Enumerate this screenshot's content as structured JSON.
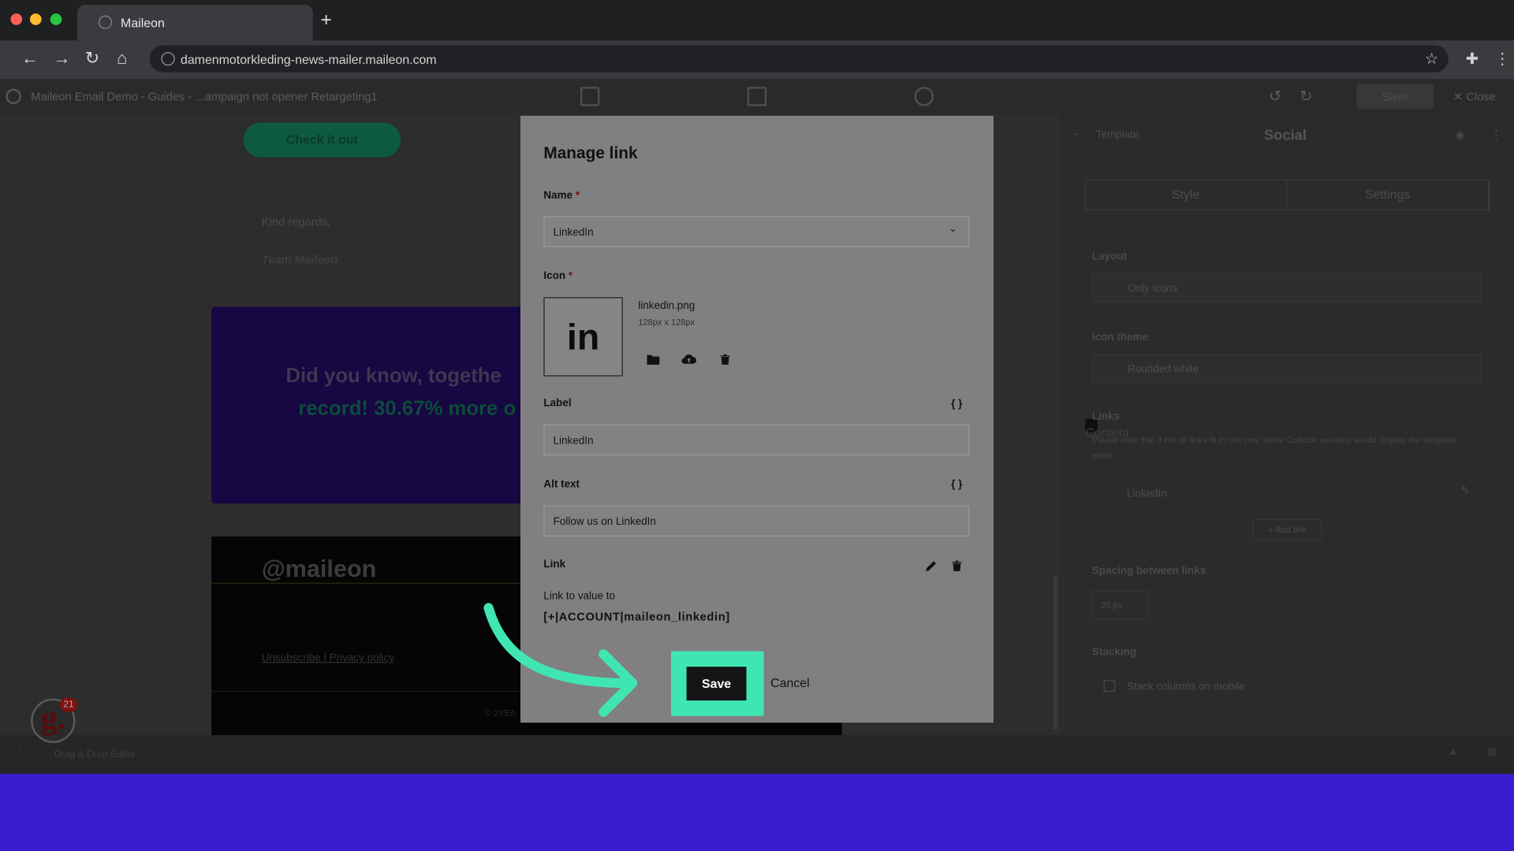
{
  "browser": {
    "tab_title": "Maileon",
    "url": "damenmotorkleding-news-mailer.maileon.com",
    "new_tab": "+"
  },
  "app_header": {
    "title": "Maileon Email Demo - Guides - ...ampaign not opener Retargeting1",
    "save": "Save",
    "close": "✕ Close"
  },
  "canvas": {
    "cta": "Check it out",
    "kind_regards": "Kind regards,",
    "team": "Team Maileon",
    "banner_line1": "Did you know, togethe",
    "banner_line2": "record! 30.67% more o",
    "footer_logo": "@maileon",
    "footer_links": "Unsubscribe | Privacy policy",
    "footer_copy": "© 2YEA"
  },
  "panel": {
    "breadcrumb": "Template",
    "title": "Social",
    "tabs": [
      "Content",
      "Style",
      "Settings"
    ],
    "layout_label": "Layout",
    "layout_value": "Only icons",
    "theme_label": "Icon theme",
    "theme_value": "Rounded white",
    "links_label": "Links",
    "links_note": "Please note that if not all links fit in one row, some Outlook versions would display the template wider.",
    "link_item": "LinkedIn",
    "add_link": "+ Add link",
    "spacing_label": "Spacing between links",
    "spacing_value": "20 px",
    "stacking_label": "Stacking",
    "stacking_checkbox": "Stack columns on mobile"
  },
  "statusbar": {
    "editor": "Drag & Drop Editor"
  },
  "avatar": {
    "letter": "g.",
    "badge": "21"
  },
  "dialog": {
    "title": "Manage link",
    "name_label": "Name",
    "name_value": "LinkedIn",
    "icon_label": "Icon",
    "icon_glyph": "in",
    "icon_filename": "linkedin.png",
    "icon_size": "128px x 128px",
    "label_label": "Label",
    "label_value": "LinkedIn",
    "alt_label": "Alt text",
    "alt_value": "Follow us on LinkedIn",
    "link_label": "Link",
    "link_to_text": "Link to value to",
    "link_value": "[+|ACCOUNT|maileon_linkedin]",
    "save": "Save",
    "cancel": "Cancel"
  },
  "colors": {
    "highlight": "#3fe6b3",
    "bottom_band": "#3b1ccf"
  },
  "icons": [
    "globe-icon",
    "back-icon",
    "forward-icon",
    "reload-icon",
    "home-icon",
    "star-icon",
    "puzzle-icon",
    "menu-icon",
    "folder-icon",
    "upload-icon",
    "trash-icon",
    "braces-icon",
    "pencil-icon",
    "arrow-pointer-icon"
  ]
}
